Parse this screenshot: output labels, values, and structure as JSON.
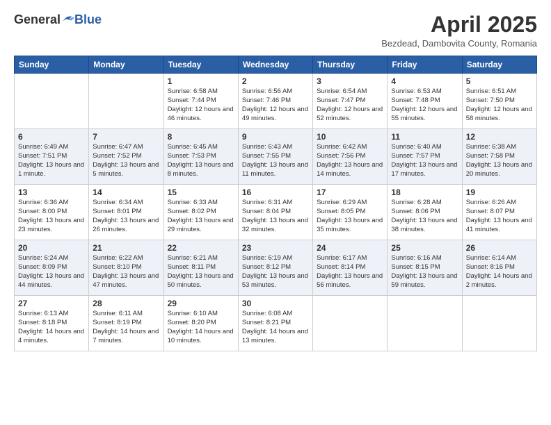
{
  "header": {
    "logo_general": "General",
    "logo_blue": "Blue",
    "month_title": "April 2025",
    "subtitle": "Bezdead, Dambovita County, Romania"
  },
  "days_of_week": [
    "Sunday",
    "Monday",
    "Tuesday",
    "Wednesday",
    "Thursday",
    "Friday",
    "Saturday"
  ],
  "weeks": [
    [
      {
        "day": "",
        "sunrise": "",
        "sunset": "",
        "daylight": ""
      },
      {
        "day": "",
        "sunrise": "",
        "sunset": "",
        "daylight": ""
      },
      {
        "day": "1",
        "sunrise": "Sunrise: 6:58 AM",
        "sunset": "Sunset: 7:44 PM",
        "daylight": "Daylight: 12 hours and 46 minutes."
      },
      {
        "day": "2",
        "sunrise": "Sunrise: 6:56 AM",
        "sunset": "Sunset: 7:46 PM",
        "daylight": "Daylight: 12 hours and 49 minutes."
      },
      {
        "day": "3",
        "sunrise": "Sunrise: 6:54 AM",
        "sunset": "Sunset: 7:47 PM",
        "daylight": "Daylight: 12 hours and 52 minutes."
      },
      {
        "day": "4",
        "sunrise": "Sunrise: 6:53 AM",
        "sunset": "Sunset: 7:48 PM",
        "daylight": "Daylight: 12 hours and 55 minutes."
      },
      {
        "day": "5",
        "sunrise": "Sunrise: 6:51 AM",
        "sunset": "Sunset: 7:50 PM",
        "daylight": "Daylight: 12 hours and 58 minutes."
      }
    ],
    [
      {
        "day": "6",
        "sunrise": "Sunrise: 6:49 AM",
        "sunset": "Sunset: 7:51 PM",
        "daylight": "Daylight: 13 hours and 1 minute."
      },
      {
        "day": "7",
        "sunrise": "Sunrise: 6:47 AM",
        "sunset": "Sunset: 7:52 PM",
        "daylight": "Daylight: 13 hours and 5 minutes."
      },
      {
        "day": "8",
        "sunrise": "Sunrise: 6:45 AM",
        "sunset": "Sunset: 7:53 PM",
        "daylight": "Daylight: 13 hours and 8 minutes."
      },
      {
        "day": "9",
        "sunrise": "Sunrise: 6:43 AM",
        "sunset": "Sunset: 7:55 PM",
        "daylight": "Daylight: 13 hours and 11 minutes."
      },
      {
        "day": "10",
        "sunrise": "Sunrise: 6:42 AM",
        "sunset": "Sunset: 7:56 PM",
        "daylight": "Daylight: 13 hours and 14 minutes."
      },
      {
        "day": "11",
        "sunrise": "Sunrise: 6:40 AM",
        "sunset": "Sunset: 7:57 PM",
        "daylight": "Daylight: 13 hours and 17 minutes."
      },
      {
        "day": "12",
        "sunrise": "Sunrise: 6:38 AM",
        "sunset": "Sunset: 7:58 PM",
        "daylight": "Daylight: 13 hours and 20 minutes."
      }
    ],
    [
      {
        "day": "13",
        "sunrise": "Sunrise: 6:36 AM",
        "sunset": "Sunset: 8:00 PM",
        "daylight": "Daylight: 13 hours and 23 minutes."
      },
      {
        "day": "14",
        "sunrise": "Sunrise: 6:34 AM",
        "sunset": "Sunset: 8:01 PM",
        "daylight": "Daylight: 13 hours and 26 minutes."
      },
      {
        "day": "15",
        "sunrise": "Sunrise: 6:33 AM",
        "sunset": "Sunset: 8:02 PM",
        "daylight": "Daylight: 13 hours and 29 minutes."
      },
      {
        "day": "16",
        "sunrise": "Sunrise: 6:31 AM",
        "sunset": "Sunset: 8:04 PM",
        "daylight": "Daylight: 13 hours and 32 minutes."
      },
      {
        "day": "17",
        "sunrise": "Sunrise: 6:29 AM",
        "sunset": "Sunset: 8:05 PM",
        "daylight": "Daylight: 13 hours and 35 minutes."
      },
      {
        "day": "18",
        "sunrise": "Sunrise: 6:28 AM",
        "sunset": "Sunset: 8:06 PM",
        "daylight": "Daylight: 13 hours and 38 minutes."
      },
      {
        "day": "19",
        "sunrise": "Sunrise: 6:26 AM",
        "sunset": "Sunset: 8:07 PM",
        "daylight": "Daylight: 13 hours and 41 minutes."
      }
    ],
    [
      {
        "day": "20",
        "sunrise": "Sunrise: 6:24 AM",
        "sunset": "Sunset: 8:09 PM",
        "daylight": "Daylight: 13 hours and 44 minutes."
      },
      {
        "day": "21",
        "sunrise": "Sunrise: 6:22 AM",
        "sunset": "Sunset: 8:10 PM",
        "daylight": "Daylight: 13 hours and 47 minutes."
      },
      {
        "day": "22",
        "sunrise": "Sunrise: 6:21 AM",
        "sunset": "Sunset: 8:11 PM",
        "daylight": "Daylight: 13 hours and 50 minutes."
      },
      {
        "day": "23",
        "sunrise": "Sunrise: 6:19 AM",
        "sunset": "Sunset: 8:12 PM",
        "daylight": "Daylight: 13 hours and 53 minutes."
      },
      {
        "day": "24",
        "sunrise": "Sunrise: 6:17 AM",
        "sunset": "Sunset: 8:14 PM",
        "daylight": "Daylight: 13 hours and 56 minutes."
      },
      {
        "day": "25",
        "sunrise": "Sunrise: 6:16 AM",
        "sunset": "Sunset: 8:15 PM",
        "daylight": "Daylight: 13 hours and 59 minutes."
      },
      {
        "day": "26",
        "sunrise": "Sunrise: 6:14 AM",
        "sunset": "Sunset: 8:16 PM",
        "daylight": "Daylight: 14 hours and 2 minutes."
      }
    ],
    [
      {
        "day": "27",
        "sunrise": "Sunrise: 6:13 AM",
        "sunset": "Sunset: 8:18 PM",
        "daylight": "Daylight: 14 hours and 4 minutes."
      },
      {
        "day": "28",
        "sunrise": "Sunrise: 6:11 AM",
        "sunset": "Sunset: 8:19 PM",
        "daylight": "Daylight: 14 hours and 7 minutes."
      },
      {
        "day": "29",
        "sunrise": "Sunrise: 6:10 AM",
        "sunset": "Sunset: 8:20 PM",
        "daylight": "Daylight: 14 hours and 10 minutes."
      },
      {
        "day": "30",
        "sunrise": "Sunrise: 6:08 AM",
        "sunset": "Sunset: 8:21 PM",
        "daylight": "Daylight: 14 hours and 13 minutes."
      },
      {
        "day": "",
        "sunrise": "",
        "sunset": "",
        "daylight": ""
      },
      {
        "day": "",
        "sunrise": "",
        "sunset": "",
        "daylight": ""
      },
      {
        "day": "",
        "sunrise": "",
        "sunset": "",
        "daylight": ""
      }
    ]
  ]
}
